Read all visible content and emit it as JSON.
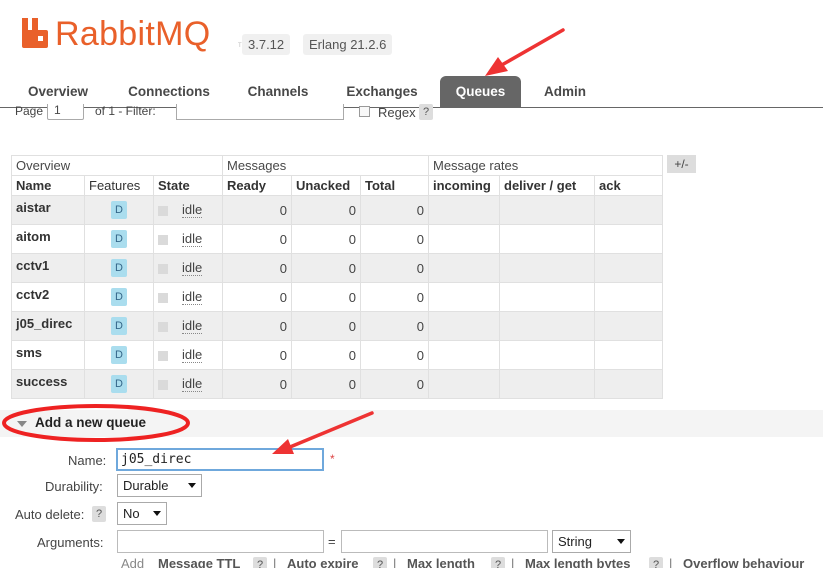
{
  "app": {
    "logo_text": "RabbitMQ",
    "logo_tm": "TM",
    "rabbit_version": "3.7.12",
    "erlang_version": "Erlang 21.2.6",
    "brand_color": "#e9602a"
  },
  "tabs": [
    {
      "label": "Overview",
      "active": false
    },
    {
      "label": "Connections",
      "active": false
    },
    {
      "label": "Channels",
      "active": false
    },
    {
      "label": "Exchanges",
      "active": false
    },
    {
      "label": "Queues",
      "active": true
    },
    {
      "label": "Admin",
      "active": false
    }
  ],
  "paging": {
    "page_label": "Page",
    "page_value": "1",
    "of_label": "of 1  - Filter:",
    "regex_label": "Regex",
    "help": "?"
  },
  "table": {
    "groups": [
      "Overview",
      "Messages",
      "Message rates"
    ],
    "columns": [
      "Name",
      "Features",
      "State",
      "Ready",
      "Unacked",
      "Total",
      "incoming",
      "deliver / get",
      "ack"
    ],
    "plus_minus": "+/-",
    "rows": [
      {
        "name": "aistar",
        "feature": "D",
        "state": "idle",
        "ready": "0",
        "unacked": "0",
        "total": "0"
      },
      {
        "name": "aitom",
        "feature": "D",
        "state": "idle",
        "ready": "0",
        "unacked": "0",
        "total": "0"
      },
      {
        "name": "cctv1",
        "feature": "D",
        "state": "idle",
        "ready": "0",
        "unacked": "0",
        "total": "0"
      },
      {
        "name": "cctv2",
        "feature": "D",
        "state": "idle",
        "ready": "0",
        "unacked": "0",
        "total": "0"
      },
      {
        "name": "j05_direc",
        "feature": "D",
        "state": "idle",
        "ready": "0",
        "unacked": "0",
        "total": "0"
      },
      {
        "name": "sms",
        "feature": "D",
        "state": "idle",
        "ready": "0",
        "unacked": "0",
        "total": "0"
      },
      {
        "name": "success",
        "feature": "D",
        "state": "idle",
        "ready": "0",
        "unacked": "0",
        "total": "0"
      }
    ]
  },
  "add_queue": {
    "title": "Add a new queue",
    "name_label": "Name:",
    "name_value": "j05_direc",
    "required_mark": "*",
    "durability_label": "Durability:",
    "durability_value": "Durable",
    "auto_delete_label": "Auto delete:",
    "auto_delete_help": "?",
    "auto_delete_value": "No",
    "arguments_label": "Arguments:",
    "arguments_eq": "=",
    "arguments_type": "String",
    "add_label": "Add",
    "links": [
      {
        "label": "Message TTL",
        "help": "?"
      },
      {
        "label": "Auto expire",
        "help": "?"
      },
      {
        "label": "Max length",
        "help": "?"
      },
      {
        "label": "Max length bytes",
        "help": "?"
      },
      {
        "label": "Overflow behaviour",
        "help": ""
      }
    ],
    "link_separator": "|"
  },
  "annotation_color": "#ee3333"
}
